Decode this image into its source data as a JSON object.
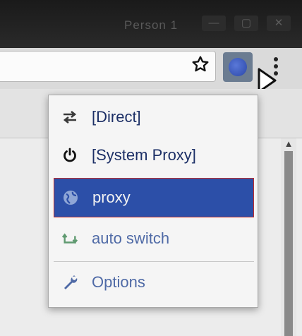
{
  "window": {
    "profile_name": "Person 1",
    "minimize_glyph": "—",
    "maximize_glyph": "▢",
    "close_glyph": "✕"
  },
  "toolbar": {
    "bookmark_icon": "star-outline-icon",
    "extension_icon": "globe-icon",
    "menu_icon": "kebab-menu-icon"
  },
  "popup": {
    "items": [
      {
        "label": "[Direct]",
        "icon": "swap-arrows-icon",
        "color": "#1c2f66",
        "selected": false
      },
      {
        "label": "[System Proxy]",
        "icon": "power-icon",
        "color": "#1c2f66",
        "selected": false
      },
      {
        "label": "proxy",
        "icon": "globe-icon",
        "color": "#f2f2f2",
        "selected": true
      },
      {
        "label": "auto switch",
        "icon": "auto-switch-icon",
        "color": "#4f6aa6",
        "selected": false
      },
      {
        "label": "Options",
        "icon": "wrench-icon",
        "color": "#4f6aa6",
        "selected": false
      }
    ],
    "selected_bg": "#2c4fa8",
    "selected_border": "#c02d2d"
  }
}
